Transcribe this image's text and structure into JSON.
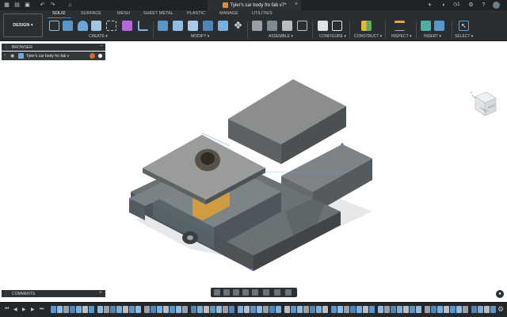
{
  "app": {
    "document_title": "Tyler's car body fro fab v7*"
  },
  "workspace": {
    "label": "DESIGN ▾"
  },
  "tabs": [
    "SOLID",
    "SURFACE",
    "MESH",
    "SHEET METAL",
    "PLASTIC",
    "MANAGE",
    "UTILITIES"
  ],
  "active_tab": "SOLID",
  "groups": [
    "CREATE ▾",
    "MODIFY ▾",
    "ASSEMBLE ▾",
    "CONFIGURE ▾",
    "CONSTRUCT ▾",
    "INSPECT ▾",
    "INSERT ▾",
    "SELECT ▾"
  ],
  "browser": {
    "header": "BROWSER",
    "root_item": "Tyler's car body fro fab v"
  },
  "comments": {
    "header": "COMMENTS"
  },
  "viewcube": {
    "face_labels": [
      "FRONT",
      "RIGHT"
    ],
    "axes": [
      "Z",
      "Y",
      "X"
    ]
  },
  "status": {
    "notifications": "1",
    "time_indicator": "1"
  },
  "colors": {
    "accent": "#2f8cd6",
    "body_gray": "#7a7f82",
    "highlight_orange": "#e0a030"
  }
}
